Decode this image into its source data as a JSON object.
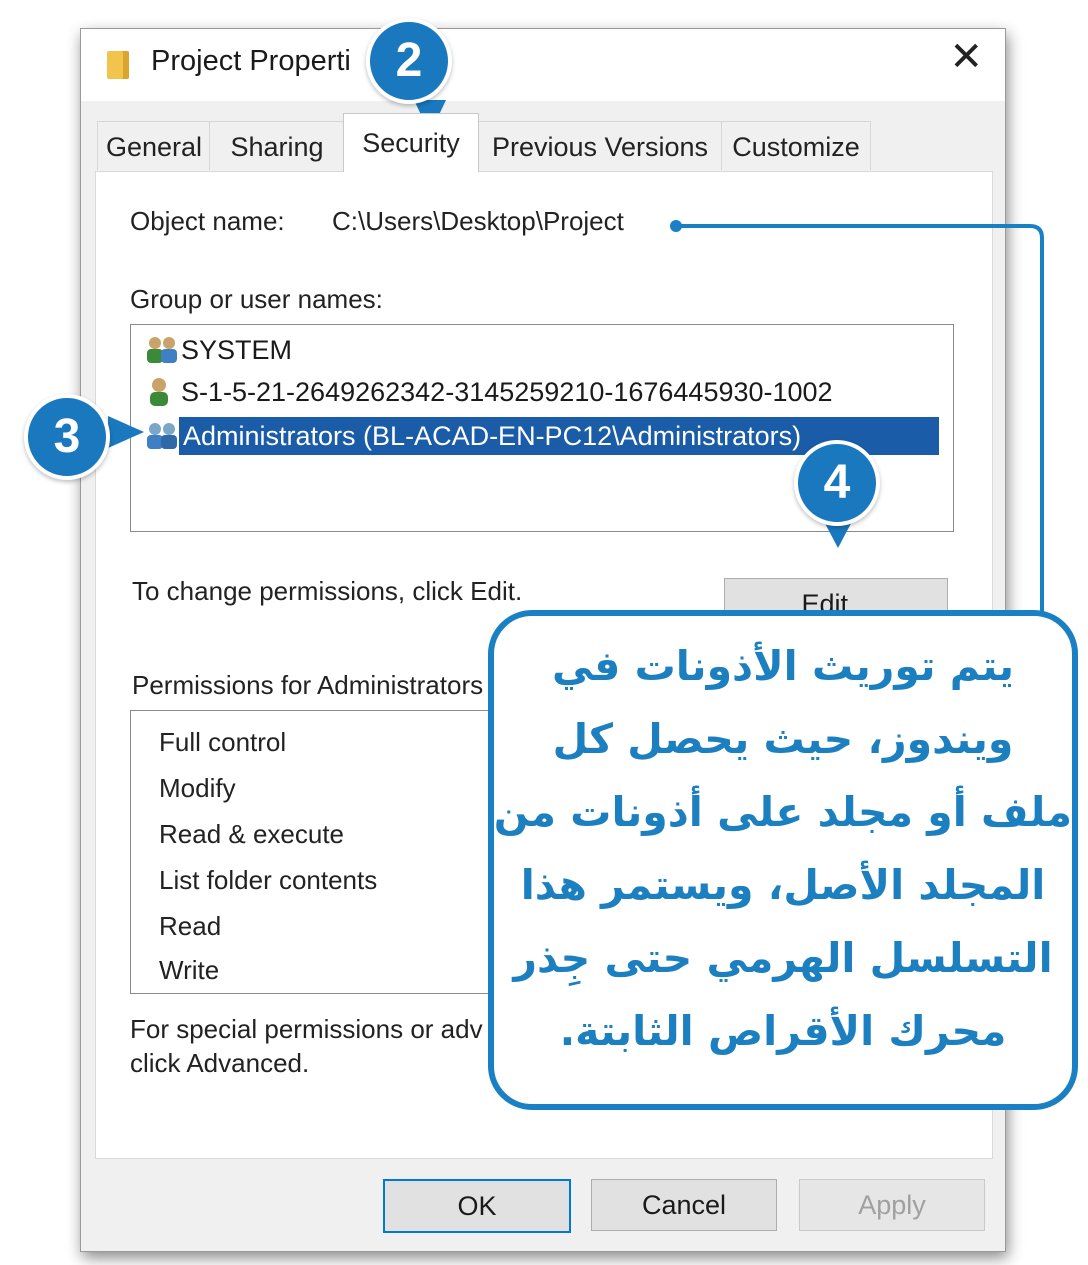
{
  "window": {
    "title": "Project Properti",
    "close_glyph": "✕"
  },
  "tabs": [
    {
      "label": "General"
    },
    {
      "label": "Sharing"
    },
    {
      "label": "Security",
      "active": true
    },
    {
      "label": "Previous Versions"
    },
    {
      "label": "Customize"
    }
  ],
  "security": {
    "object_name_label": "Object name:",
    "object_name_value": "C:\\Users\\Desktop\\Project",
    "group_label": "Group or user names:",
    "users": [
      {
        "name": "SYSTEM",
        "icon": "group-users-icon"
      },
      {
        "name": "S-1-5-21-2649262342-3145259210-1676445930-1002",
        "icon": "user-icon"
      },
      {
        "name": "Administrators (BL-ACAD-EN-PC12\\Administrators)",
        "icon": "group-users-icon",
        "selected": true
      }
    ],
    "change_hint": "To change permissions, click Edit.",
    "edit_button": "Edit...",
    "permissions_label": "Permissions for Administrators",
    "permissions": [
      "Full control",
      "Modify",
      "Read & execute",
      "List folder contents",
      "Read",
      "Write"
    ],
    "special_line1": "For special permissions or adv",
    "special_line2": "click Advanced."
  },
  "buttons": {
    "ok": "OK",
    "cancel": "Cancel",
    "apply": "Apply"
  },
  "callout": {
    "lines": [
      "يتم توريث الأذونات في",
      "ويندوز، حيث يحصل كل",
      "ملف أو مجلد على أذونات من",
      "المجلد الأصل، ويستمر هذا",
      "التسلسل الهرمي حتى جِذر",
      "محرك الأقراص الثابتة."
    ]
  },
  "markers": {
    "tab": "2",
    "user": "3",
    "edit": "4"
  },
  "colors": {
    "accent": "#1a78be",
    "selection": "#1a5ca8",
    "callout_text": "#1c7fc0"
  }
}
